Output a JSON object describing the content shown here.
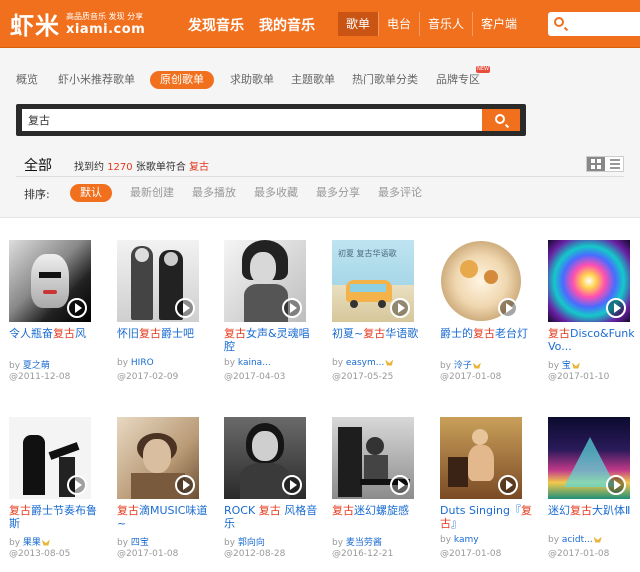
{
  "header": {
    "logo_text": "虾米",
    "logo_tagline": "高品质音乐 发现 分享",
    "logo_domain": "xiami.com",
    "nav_main": [
      "发现音乐",
      "我的音乐"
    ],
    "tabs": [
      "歌单",
      "电台",
      "音乐人",
      "客户端"
    ],
    "active_tab": "歌单"
  },
  "subnav": {
    "items": [
      "概览",
      "虾小米推荐歌单",
      "原创歌单",
      "求助歌单",
      "主题歌单",
      "热门歌单分类",
      "品牌专区"
    ],
    "active": "原创歌单",
    "badge": "NEW"
  },
  "search": {
    "value": "复古"
  },
  "results": {
    "all_label": "全部",
    "prefix": "找到约",
    "count": "1270",
    "middle": "张歌单符合",
    "keyword": "复古"
  },
  "sort": {
    "label": "排序:",
    "options": [
      "默认",
      "最新创建",
      "最多播放",
      "最多收藏",
      "最多分享",
      "最多评论"
    ],
    "active": "默认"
  },
  "playlists": [
    {
      "pre": "令人瓶奋",
      "kw": "复古",
      "post": "风",
      "author": "夏之萌",
      "vip": false,
      "date": "@2011-12-08"
    },
    {
      "pre": "怀旧",
      "kw": "复古",
      "post": "爵士吧",
      "author": "HIRO",
      "vip": false,
      "date": "@2017-02-09"
    },
    {
      "pre": "",
      "kw": "复古",
      "post": "女声&灵魂唱腔",
      "author": "kaina...",
      "vip": false,
      "date": "@2017-04-03"
    },
    {
      "pre": "初夏~",
      "kw": "复古",
      "post": "华语歌",
      "author": "easym...",
      "vip": true,
      "date": "@2017-05-25"
    },
    {
      "pre": "爵士的",
      "kw": "复古",
      "post": "老台灯",
      "author": "泠子",
      "vip": true,
      "date": "@2017-01-08"
    },
    {
      "pre": "",
      "kw": "复古",
      "post": "Disco&Funk Vo...",
      "author": "宝",
      "vip": true,
      "date": "@2017-01-10"
    },
    {
      "pre": "",
      "kw": "复古",
      "post": "爵士节奏布鲁斯",
      "author": "果果",
      "vip": true,
      "date": "@2013-08-05"
    },
    {
      "pre": "",
      "kw": "复古",
      "post": "滴MUSIC味道~",
      "author": "四宝",
      "vip": false,
      "date": "@2017-01-08"
    },
    {
      "pre": "ROCK ",
      "kw": "复古",
      "post": " 风格音乐",
      "author": "郭向向",
      "vip": false,
      "date": "@2012-08-28"
    },
    {
      "pre": "",
      "kw": "复古",
      "post": "迷幻螺旋感",
      "author": "麦当劳酱",
      "vip": false,
      "date": "@2016-12-21"
    },
    {
      "pre": "Duts Singing『",
      "kw": "复古",
      "post": "』",
      "author": "kamy",
      "vip": false,
      "date": "@2017-01-08"
    },
    {
      "pre": "迷幻",
      "kw": "复古",
      "post": "大趴体Ⅱ",
      "author": "acidt...",
      "vip": true,
      "date": "@2017-01-08"
    }
  ],
  "cover_note_1": "初夏",
  "cover_note_2": "复古华语歌"
}
